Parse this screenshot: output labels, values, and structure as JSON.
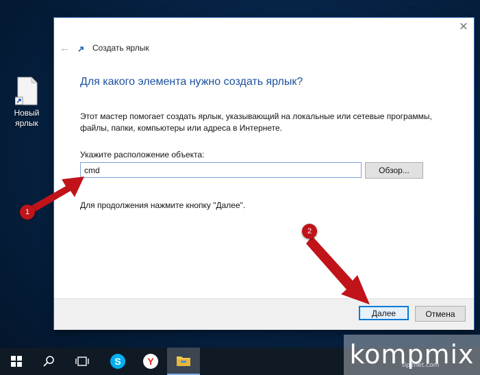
{
  "desktop": {
    "icon_label_line1": "Новый",
    "icon_label_line2": "ярлык"
  },
  "dialog": {
    "window_title": "Создать ярлык",
    "heading": "Для какого элемента нужно создать ярлык?",
    "description_line1": "Этот мастер помогает создать ярлык, указывающий на локальные или сетевые программы,",
    "description_line2": "файлы, папки, компьютеры или адреса в Интернете.",
    "location_label": "Укажите расположение объекта:",
    "location_value": "cmd",
    "browse_label": "Обзор...",
    "hint": "Для продолжения нажмите кнопку \"Далее\".",
    "next_label": "Далее",
    "cancel_label": "Отмена",
    "close_icon": "close-icon",
    "back_icon": "back-arrow-icon"
  },
  "annotations": {
    "marker1": "1",
    "marker2": "2",
    "arrow_color": "#c0141a"
  },
  "taskbar": {
    "icons": [
      "windows-start-icon",
      "search-icon",
      "task-view-icon",
      "skype-icon",
      "yandex-browser-icon",
      "file-explorer-icon"
    ]
  },
  "watermark": {
    "text": "kompmix",
    "subtext": "tip2net.com"
  },
  "colors": {
    "accent": "#0078d7",
    "heading": "#1a4f9c",
    "taskbar": "#101a24"
  }
}
